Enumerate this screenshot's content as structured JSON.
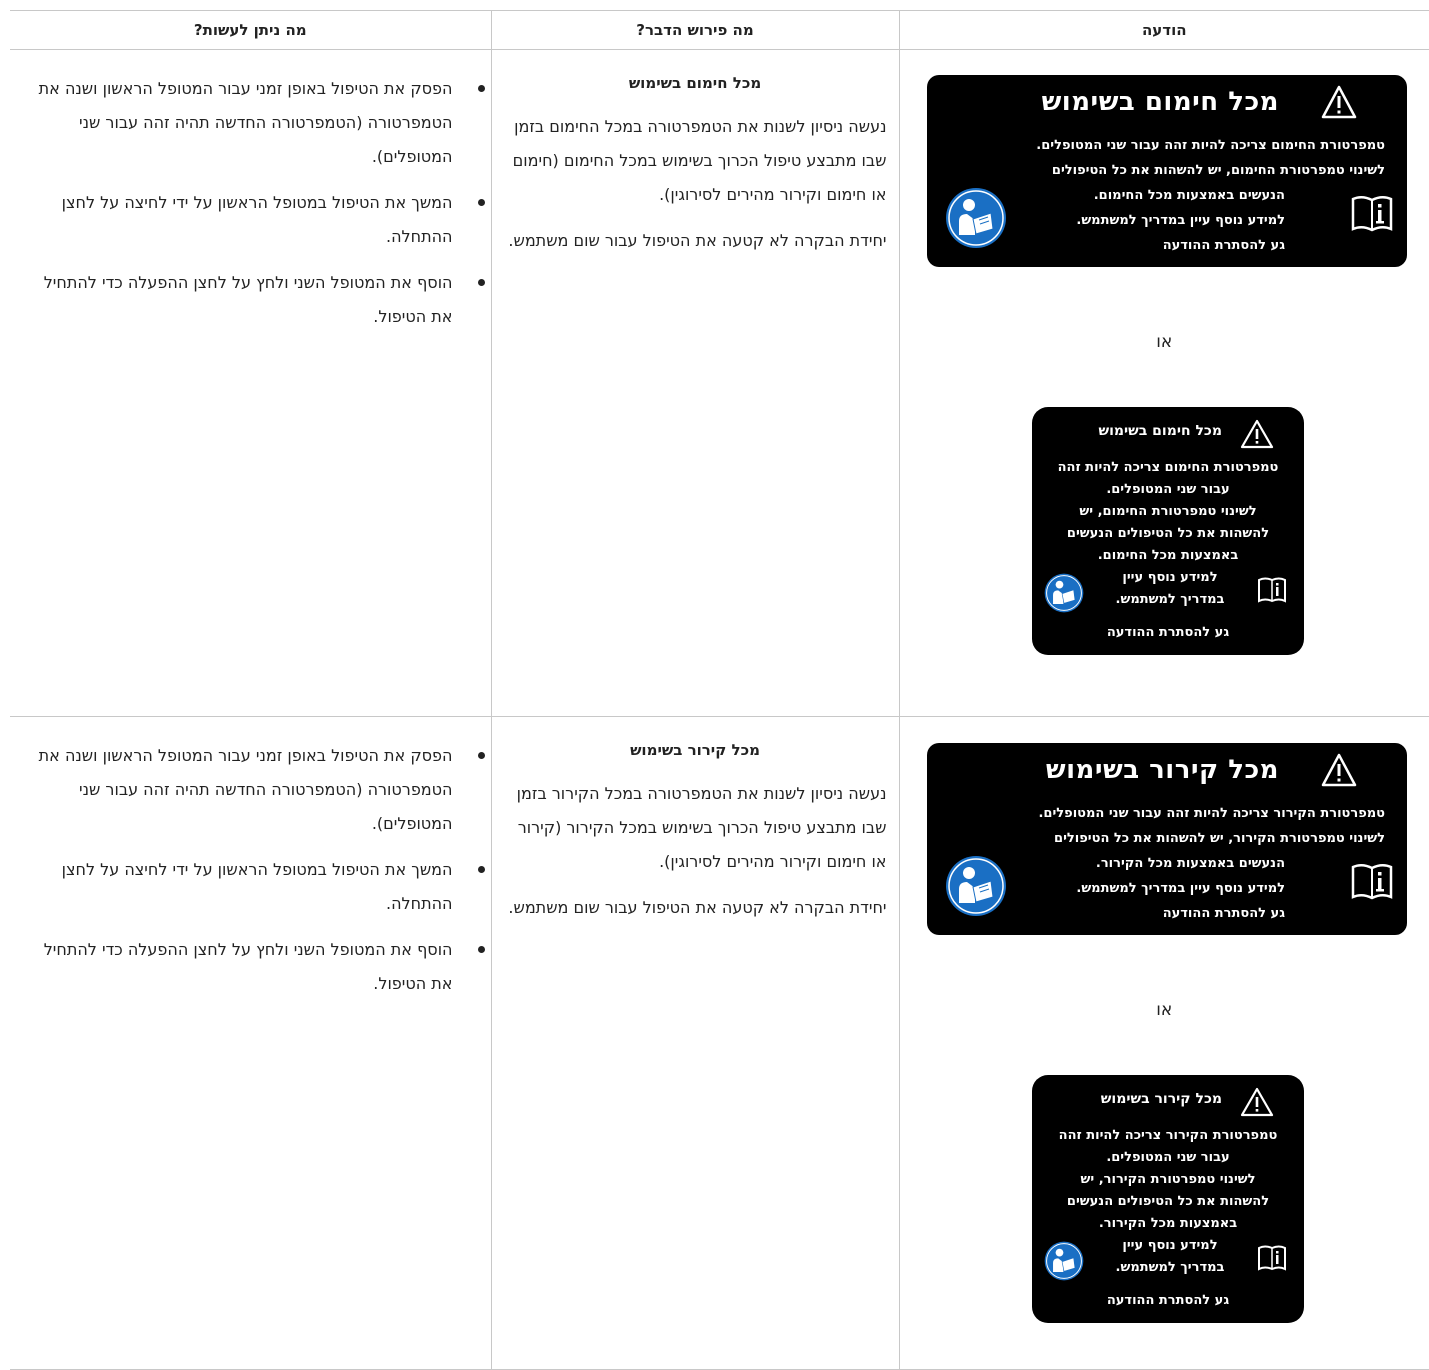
{
  "headers": {
    "notification": "הודעה",
    "meaning": "מה פירוש הדבר?",
    "action": "מה ניתן לעשות?"
  },
  "or_label": "או",
  "rows": [
    {
      "wide": {
        "title": "מכל חימום בשימוש",
        "line1": "טמפרטורת החימום צריכה להיות זהה עבור שני המטופלים.",
        "line2": "לשינוי טמפרטורת החימום, יש להשהות את כל הטיפולים",
        "line3": "הנעשים באמצעות מכל החימום.",
        "line4": "למידע נוסף עיין במדריך למשתמש.",
        "line5": "גע להסתרת ההודעה"
      },
      "small": {
        "title": "מכל חימום בשימוש",
        "line1": "טמפרטורת החימום צריכה להיות זהה",
        "line2": "עבור שני המטופלים.",
        "line3": "לשינוי טמפרטורת החימום, יש",
        "line4": "להשהות את כל הטיפולים הנעשים",
        "line5": "באמצעות מכל החימום.",
        "more1": "למידע נוסף עיין",
        "more2": "במדריך למשתמש.",
        "dismiss": "גע להסתרת ההודעה"
      },
      "meaning_title": "מכל חימום בשימוש",
      "meaning_p1": "נעשה ניסיון לשנות את הטמפרטורה במכל החימום בזמן שבו מתבצע טיפול הכרוך בשימוש במכל החימום (חימום או חימום וקירור מהירים לסירוגין).",
      "meaning_p2": "יחידת הבקרה לא קטעה את הטיפול עבור שום משתמש.",
      "actions": [
        "הפסק את הטיפול באופן זמני עבור המטופל הראשון ושנה את הטמפרטורה (הטמפרטורה החדשה תהיה זהה עבור שני המטופלים).",
        "המשך את הטיפול במטופל הראשון על ידי לחיצה על לחצן ההתחלה.",
        "הוסף את המטופל השני ולחץ על לחצן ההפעלה כדי להתחיל את הטיפול."
      ]
    },
    {
      "wide": {
        "title": "מכל קירור בשימוש",
        "line1": "טמפרטורת הקירור צריכה להיות זהה עבור שני המטופלים.",
        "line2": "לשינוי טמפרטורת הקירור, יש להשהות את כל הטיפולים",
        "line3": "הנעשים באמצעות מכל הקירור.",
        "line4": "למידע נוסף עיין במדריך למשתמש.",
        "line5": "גע להסתרת ההודעה"
      },
      "small": {
        "title": "מכל קירור בשימוש",
        "line1": "טמפרטורת הקירור צריכה להיות זהה",
        "line2": "עבור שני המטופלים.",
        "line3": "לשינוי טמפרטורת הקירור, יש",
        "line4": "להשהות את כל הטיפולים הנעשים",
        "line5": "באמצעות מכל הקירור.",
        "more1": "למידע נוסף עיין",
        "more2": "במדריך למשתמש.",
        "dismiss": "גע להסתרת ההודעה"
      },
      "meaning_title": "מכל קירור בשימוש",
      "meaning_p1": "נעשה ניסיון לשנות את הטמפרטורה במכל הקירור בזמן שבו מתבצע טיפול הכרוך בשימוש במכל הקירור (קירור או חימום וקירור מהירים לסירוגין).",
      "meaning_p2": "יחידת הבקרה לא קטעה את הטיפול עבור שום משתמש.",
      "actions": [
        "הפסק את הטיפול באופן זמני עבור המטופל הראשון ושנה את הטמפרטורה (הטמפרטורה החדשה תהיה זהה עבור שני המטופלים).",
        "המשך את הטיפול במטופל הראשון על ידי לחיצה על לחצן ההתחלה.",
        "הוסף את המטופל השני ולחץ על לחצן ההפעלה כדי להתחיל את הטיפול."
      ]
    }
  ]
}
